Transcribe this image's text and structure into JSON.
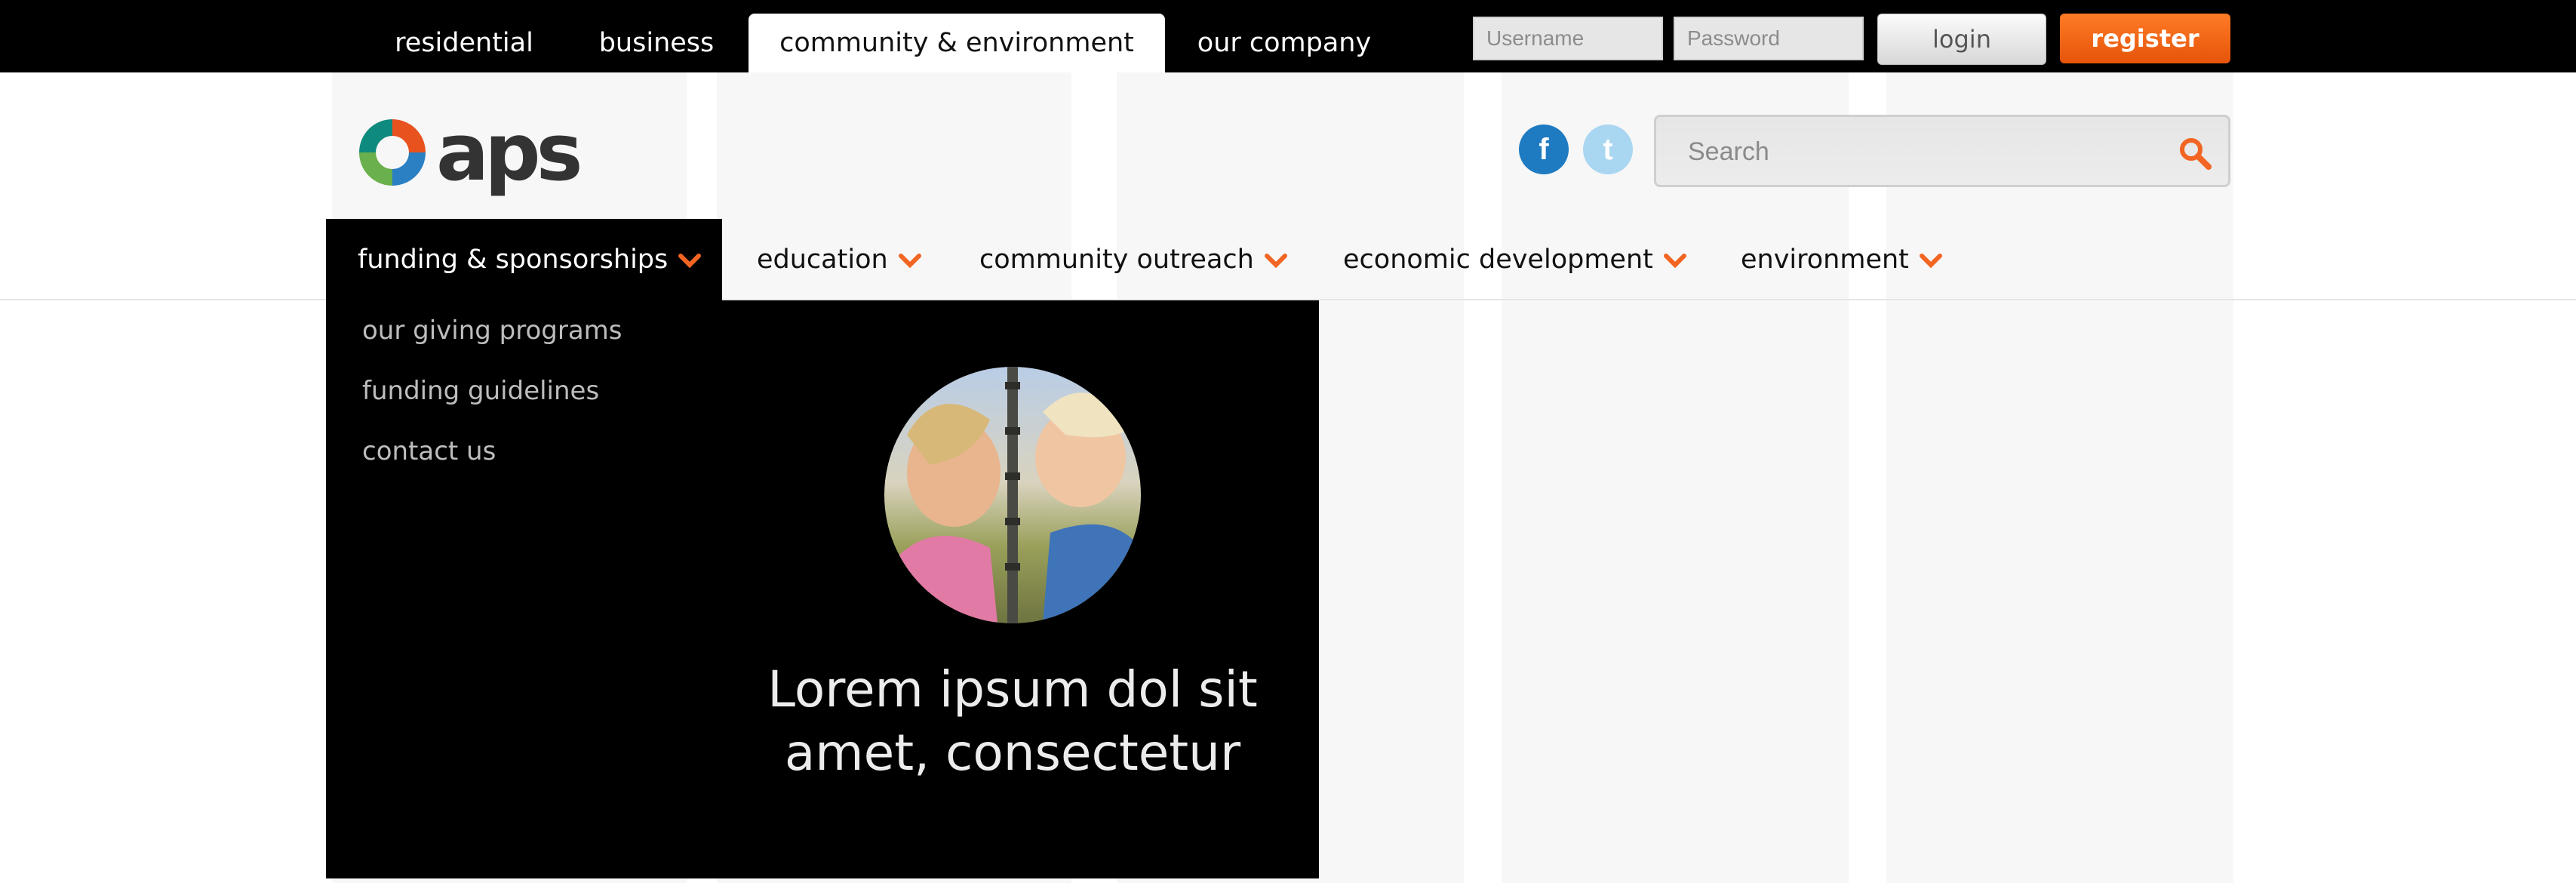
{
  "top_nav": {
    "tabs": [
      {
        "label": "residential",
        "active": false
      },
      {
        "label": "business",
        "active": false
      },
      {
        "label": "community & environment",
        "active": true
      },
      {
        "label": "our company",
        "active": false
      }
    ]
  },
  "account": {
    "username_placeholder": "Username",
    "password_placeholder": "Password",
    "login_label": "login",
    "register_label": "register"
  },
  "logo": {
    "text": "aps"
  },
  "social": {
    "facebook_glyph": "f",
    "twitter_glyph": "t"
  },
  "search": {
    "placeholder": "Search"
  },
  "section_nav": {
    "items": [
      {
        "label": "funding & sponsorships",
        "active": true
      },
      {
        "label": "education",
        "active": false
      },
      {
        "label": "community outreach",
        "active": false
      },
      {
        "label": "economic development",
        "active": false
      },
      {
        "label": "environment",
        "active": false
      }
    ]
  },
  "dropdown": {
    "links": [
      "our giving programs",
      "funding guidelines",
      "contact us"
    ],
    "caption_line1": "Lorem ipsum dol sit",
    "caption_line2": "amet, consectetur"
  },
  "colors": {
    "accent": "#f26522",
    "bar": "#000000",
    "facebook": "#1f7bc1",
    "twitter": "#a9d6f1"
  },
  "icons": [
    "facebook-icon",
    "twitter-icon",
    "search-icon",
    "chevron-down-icon"
  ]
}
